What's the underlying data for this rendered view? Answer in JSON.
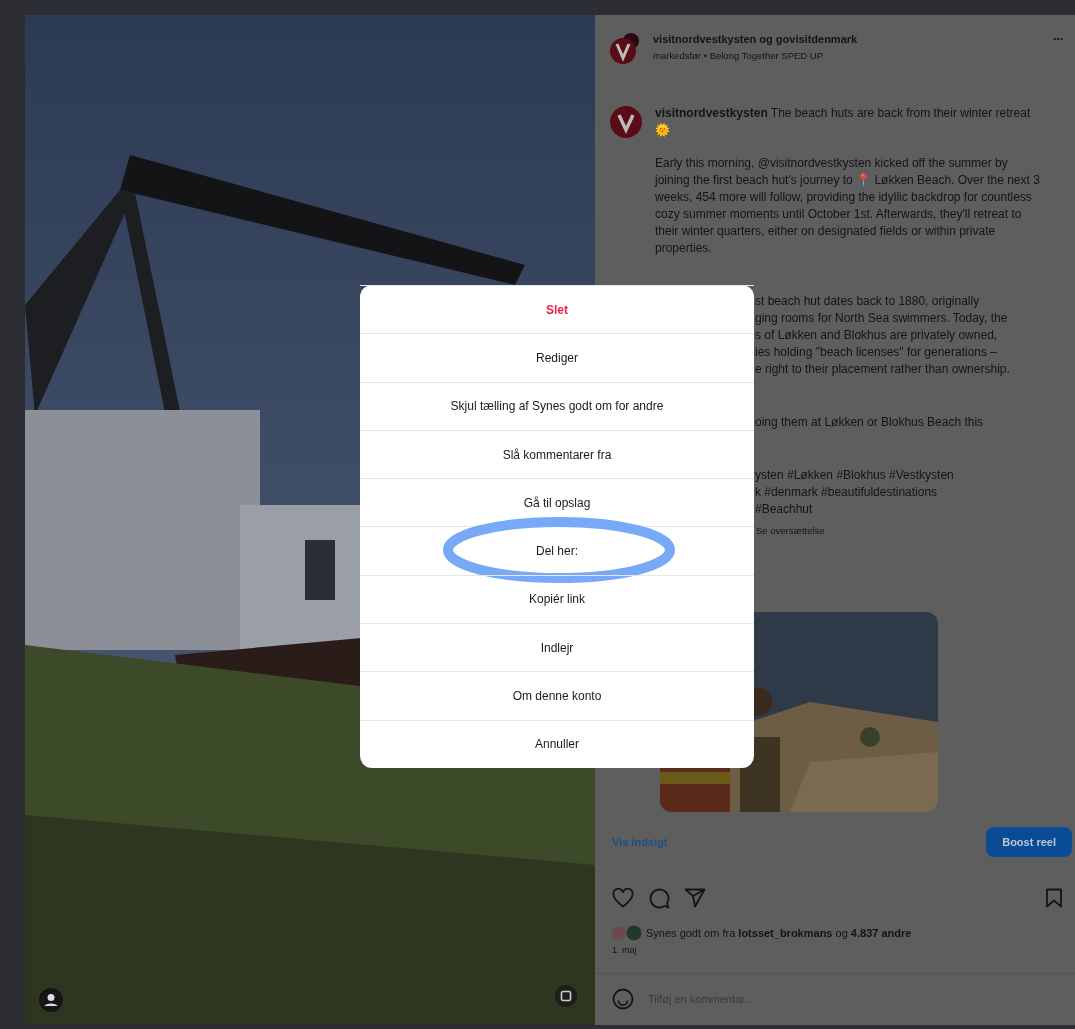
{
  "post": {
    "header": {
      "account": "visitnordvestkysten og govisitdenmark",
      "subtitle": "markedsfør • Belong Together SPED UP",
      "more": "···"
    },
    "caption": {
      "first": "**visitnordvestkysten** The beach huts are back from their winter retreat",
      "emoji": "🌞",
      "paragraph": "Early this morning, @visitnordvestkysten kicked off the summer by joining the first beach hut's journey to 📍 Løkken Beach. Over the next 3 weeks, 454 more will follow, providing the idyllic backdrop for countless cozy summer moments until October 1st. Afterwards, they'll retreat to their winter quarters, either on designated fields or within private properties.",
      "partial_paragraphs": [
        [
          "st beach hut dates back to 1880, originally",
          "ging rooms for North Sea swimmers. Today, the",
          "s of Løkken and Blokhus are privately owned,",
          "ies holding \"beach licenses\" for generations –",
          "e right to their placement rather than ownership."
        ],
        [
          "oing them at Løkken or Blokhus Beach this"
        ],
        [
          "ysten #Løkken #Blokhus #Vestkysten",
          "k #denmark #beautifuldestinations",
          "#Beachhut"
        ]
      ],
      "translate": "Se oversættelse"
    },
    "insights": "Vis indsigt",
    "boost": "Boost reel",
    "likes": "Synes godt om fra **lotsset_brokmans** og **4.837 andre**",
    "date": "1. maj",
    "comment": {
      "placeholder": "Tilføj en kommentar..."
    }
  },
  "menu": {
    "items": [
      {
        "label": "Slet",
        "kind": "danger",
        "circled": false
      },
      {
        "label": "Rediger",
        "kind": "normal",
        "circled": false
      },
      {
        "label": "Skjul tælling af Synes godt om for andre",
        "kind": "normal",
        "circled": false
      },
      {
        "label": "Slå kommentarer fra",
        "kind": "normal",
        "circled": false
      },
      {
        "label": "Gå til opslag",
        "kind": "normal",
        "circled": false
      },
      {
        "label": "Del her:",
        "kind": "normal",
        "circled": true
      },
      {
        "label": "Kopiér link",
        "kind": "normal",
        "circled": false
      },
      {
        "label": "Indlejr",
        "kind": "normal",
        "circled": false
      },
      {
        "label": "Om denne konto",
        "kind": "normal",
        "circled": false
      },
      {
        "label": "Annuller",
        "kind": "normal",
        "circled": false
      }
    ]
  }
}
